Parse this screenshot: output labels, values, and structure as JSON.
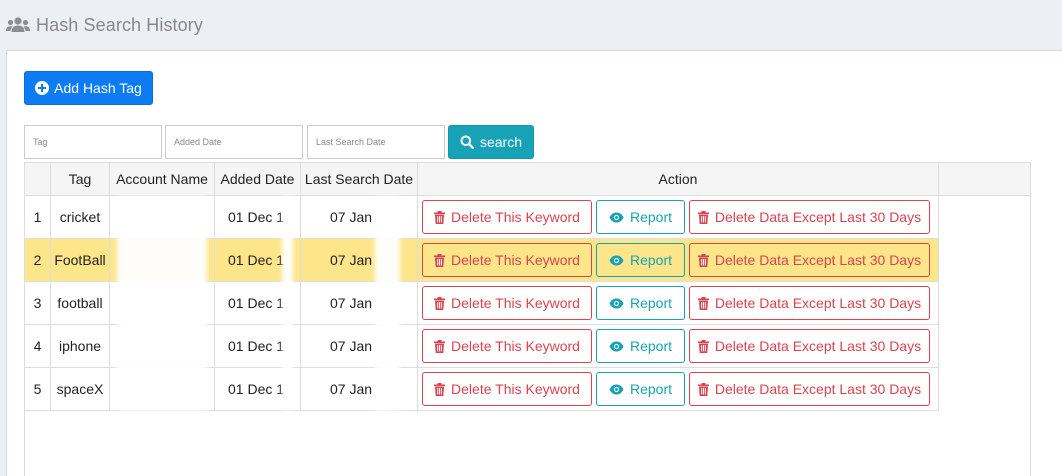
{
  "header": {
    "title": "Hash Search History",
    "icon": "users-icon"
  },
  "toolbar": {
    "add_label": "Add Hash Tag",
    "add_icon": "plus-circle-icon"
  },
  "filters": {
    "tag_placeholder": "Tag",
    "added_placeholder": "Added Date",
    "last_placeholder": "Last Search Date",
    "search_label": "search",
    "search_icon": "search-icon"
  },
  "table": {
    "columns": [
      "",
      "Tag",
      "Account Name",
      "Added Date",
      "Last Search Date",
      "Action"
    ],
    "rows": [
      {
        "num": "1",
        "tag": "cricket",
        "account": "",
        "added": "01 Dec 1",
        "last": "07 Jan",
        "selected": false
      },
      {
        "num": "2",
        "tag": "FootBall",
        "account": "",
        "added": "01 Dec 1",
        "last": "07 Jan",
        "selected": true
      },
      {
        "num": "3",
        "tag": "football",
        "account": "",
        "added": "01 Dec 1",
        "last": "07 Jan",
        "selected": false
      },
      {
        "num": "4",
        "tag": "iphone",
        "account": "",
        "added": "01 Dec 1",
        "last": "07 Jan",
        "selected": false
      },
      {
        "num": "5",
        "tag": "spaceX",
        "account": "",
        "added": "01 Dec 1",
        "last": "07 Jan",
        "selected": false
      }
    ],
    "actions": {
      "delete_label": "Delete This Keyword",
      "report_label": "Report",
      "except_label": "Delete Data Except Last 30 Days"
    }
  },
  "colors": {
    "primary": "#0d7cf2",
    "info": "#17a2b8",
    "danger": "#d9434e",
    "selected_row": "#fde58a"
  }
}
